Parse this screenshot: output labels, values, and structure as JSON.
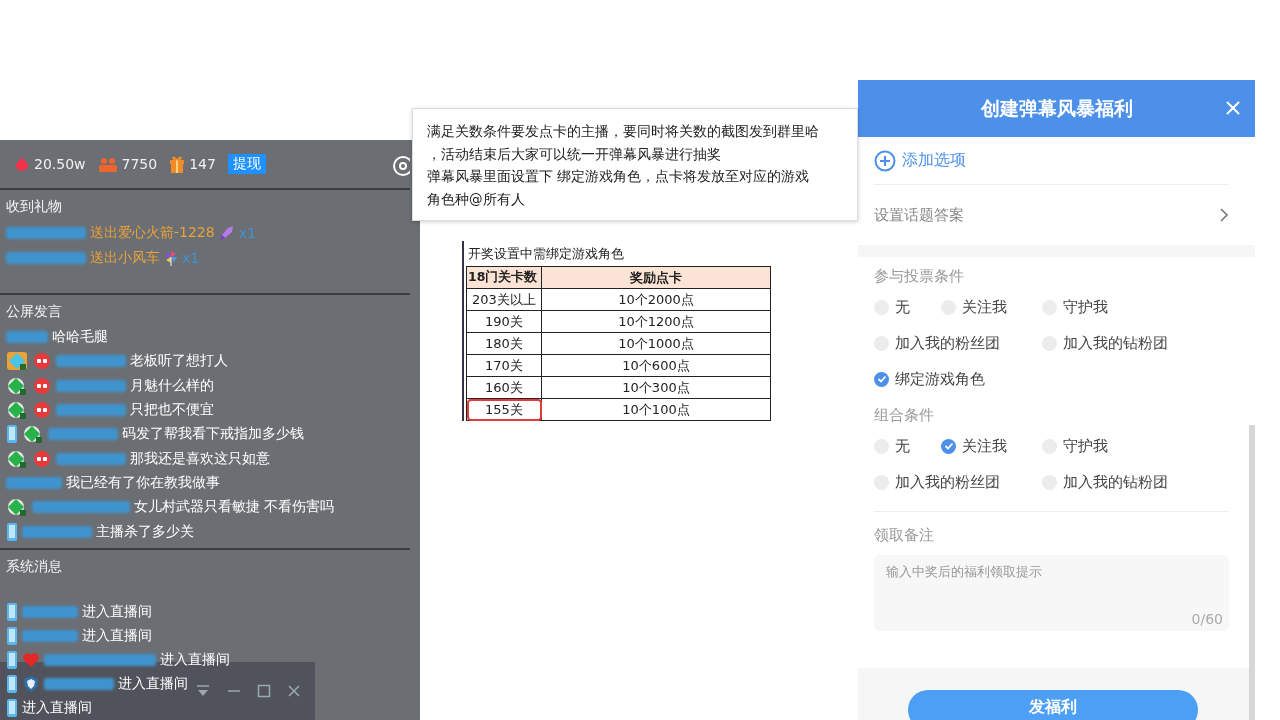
{
  "stats": [
    {
      "kind": "likes",
      "value": "20.50w"
    },
    {
      "kind": "fans",
      "value": "7750"
    },
    {
      "kind": "gifts",
      "value": "147"
    }
  ],
  "withdraw_button": "提现",
  "gifts": {
    "title": "收到礼物",
    "rows": [
      {
        "action": "送出爱心火箭-1228",
        "count": "x1"
      },
      {
        "action": "送出小风车",
        "count": "x1"
      }
    ]
  },
  "chat": {
    "title": "公屏发言",
    "messages": [
      {
        "text": "哈哈毛腿"
      },
      {
        "text": "老板听了想打人"
      },
      {
        "text": "月魅什么样的"
      },
      {
        "text": "只把也不便宜"
      },
      {
        "text": "码发了帮我看下戒指加多少钱"
      },
      {
        "text": "那我还是喜欢这只如意"
      },
      {
        "text": "我已经有了你在教我做事"
      },
      {
        "text": "女儿村武器只看敏捷 不看伤害吗"
      },
      {
        "text": "主播杀了多少关"
      }
    ]
  },
  "system": {
    "title": "系统消息",
    "messages": [
      {
        "text": "进入直播间"
      },
      {
        "text": "进入直播间"
      },
      {
        "text": "进入直播间"
      },
      {
        "text": "进入直播间"
      },
      {
        "text": "进入直播间"
      }
    ]
  },
  "note": {
    "lines": [
      "满足关数条件要发点卡的主播，要同时将关数的截图发到群里哈",
      "，活动结束后大家可以统一开弹幕风暴进行抽奖",
      "弹幕风暴里面设置下  绑定游戏角色，点卡将发放至对应的游戏",
      "角色种@所有人"
    ]
  },
  "table": {
    "caption": "开奖设置中需绑定游戏角色",
    "columns": [
      "18门关卡数",
      "奖励点卡"
    ],
    "rows": [
      {
        "cells": [
          "203关以上",
          "10个2000点"
        ],
        "highlighted": false
      },
      {
        "cells": [
          "190关",
          "10个1200点"
        ],
        "highlighted": false
      },
      {
        "cells": [
          "180关",
          "10个1000点"
        ],
        "highlighted": false
      },
      {
        "cells": [
          "170关",
          "10个600点"
        ],
        "highlighted": false
      },
      {
        "cells": [
          "160关",
          "10个300点"
        ],
        "highlighted": false
      },
      {
        "cells": [
          "155关",
          "10个100点"
        ],
        "highlighted": true
      }
    ]
  },
  "dialog": {
    "title": "创建弹幕风暴福利",
    "add_option": "添加选项",
    "topic_answer": "设置话题答案",
    "vote_conditions": {
      "title": "参与投票条件",
      "options": [
        {
          "label": "无",
          "checked": false
        },
        {
          "label": "关注我",
          "checked": false
        },
        {
          "label": "守护我",
          "checked": false
        },
        {
          "label": "加入我的粉丝团",
          "checked": false
        },
        {
          "label": "加入我的钻粉团",
          "checked": false
        },
        {
          "label": "绑定游戏角色",
          "checked": true
        }
      ]
    },
    "combo_conditions": {
      "title": "组合条件",
      "options": [
        {
          "label": "无",
          "checked": false
        },
        {
          "label": "关注我",
          "checked": true
        },
        {
          "label": "守护我",
          "checked": false
        },
        {
          "label": "加入我的粉丝团",
          "checked": false
        },
        {
          "label": "加入我的钻粉团",
          "checked": false
        }
      ]
    },
    "note_field": {
      "label": "领取备注",
      "placeholder": "输入中奖后的福利领取提示",
      "counter": "0/60"
    },
    "submit": "发福利"
  }
}
